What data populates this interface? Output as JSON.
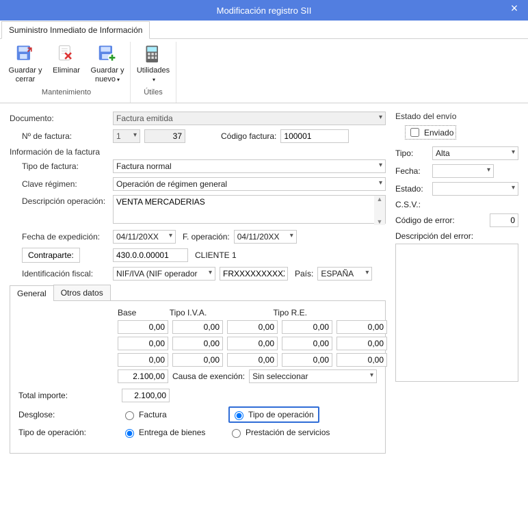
{
  "titlebar": {
    "title": "Modificación registro SII"
  },
  "ribbon": {
    "tab_label": "Suministro Inmediato de Información",
    "groups": {
      "mantenimiento": {
        "title": "Mantenimiento",
        "guardar_cerrar": "Guardar y cerrar",
        "eliminar": "Eliminar",
        "guardar_nuevo": "Guardar y nuevo"
      },
      "utiles": {
        "title": "Útiles",
        "utilidades": "Utilidades"
      }
    }
  },
  "form": {
    "documento_label": "Documento:",
    "documento_value": "Factura emitida",
    "nfactura_label": "Nº de factura:",
    "nfactura_serie": "1",
    "nfactura_num": "37",
    "codfactura_label": "Código factura:",
    "codfactura_value": "100001",
    "info_header": "Información de la factura",
    "tipo_factura_label": "Tipo de factura:",
    "tipo_factura_value": "Factura normal",
    "clave_regimen_label": "Clave régimen:",
    "clave_regimen_value": "Operación de régimen general",
    "desc_op_label": "Descripción operación:",
    "desc_op_value": "VENTA MERCADERIAS",
    "fecha_exp_label": "Fecha de expedición:",
    "fecha_exp_value": "04/11/20XX",
    "fecha_op_label": "F. operación:",
    "fecha_op_value": "04/11/20XX",
    "contraparte_btn": "Contraparte:",
    "contraparte_code": "430.0.0.00001",
    "contraparte_name": "CLIENTE 1",
    "id_fiscal_label": "Identificación fiscal:",
    "id_fiscal_tipo": "NIF/IVA (NIF operador",
    "id_fiscal_num": "FRXXXXXXXXXX",
    "pais_label": "País:",
    "pais_value": "ESPAÑA"
  },
  "tabs": {
    "general_label": "General",
    "otros_label": "Otros datos",
    "headers": {
      "base": "Base",
      "tipo_iva": "Tipo I.V.A.",
      "tipo_re": "Tipo R.E."
    },
    "rows": [
      {
        "base": "0,00",
        "tiva": "0,00",
        "iva": "0,00",
        "tre": "0,00",
        "re": "0,00"
      },
      {
        "base": "0,00",
        "tiva": "0,00",
        "iva": "0,00",
        "tre": "0,00",
        "re": "0,00"
      },
      {
        "base": "0,00",
        "tiva": "0,00",
        "iva": "0,00",
        "tre": "0,00",
        "re": "0,00"
      }
    ],
    "total_base": "2.100,00",
    "causa_exencion_label": "Causa de exención:",
    "causa_exencion_value": "Sin seleccionar",
    "total_importe_label": "Total importe:",
    "total_importe_value": "2.100,00",
    "desglose_label": "Desglose:",
    "desglose_factura": "Factura",
    "desglose_tipo_op": "Tipo de operación",
    "tipo_op_label": "Tipo de operación:",
    "tipo_op_entrega": "Entrega de bienes",
    "tipo_op_prestacion": "Prestación de servicios"
  },
  "estado": {
    "header": "Estado del envío",
    "enviado_label": "Enviado",
    "tipo_label": "Tipo:",
    "tipo_value": "Alta",
    "fecha_label": "Fecha:",
    "estado_label": "Estado:",
    "csv_label": "C.S.V.:",
    "cod_error_label": "Código de error:",
    "cod_error_value": "0",
    "desc_error_label": "Descripción del error:"
  }
}
